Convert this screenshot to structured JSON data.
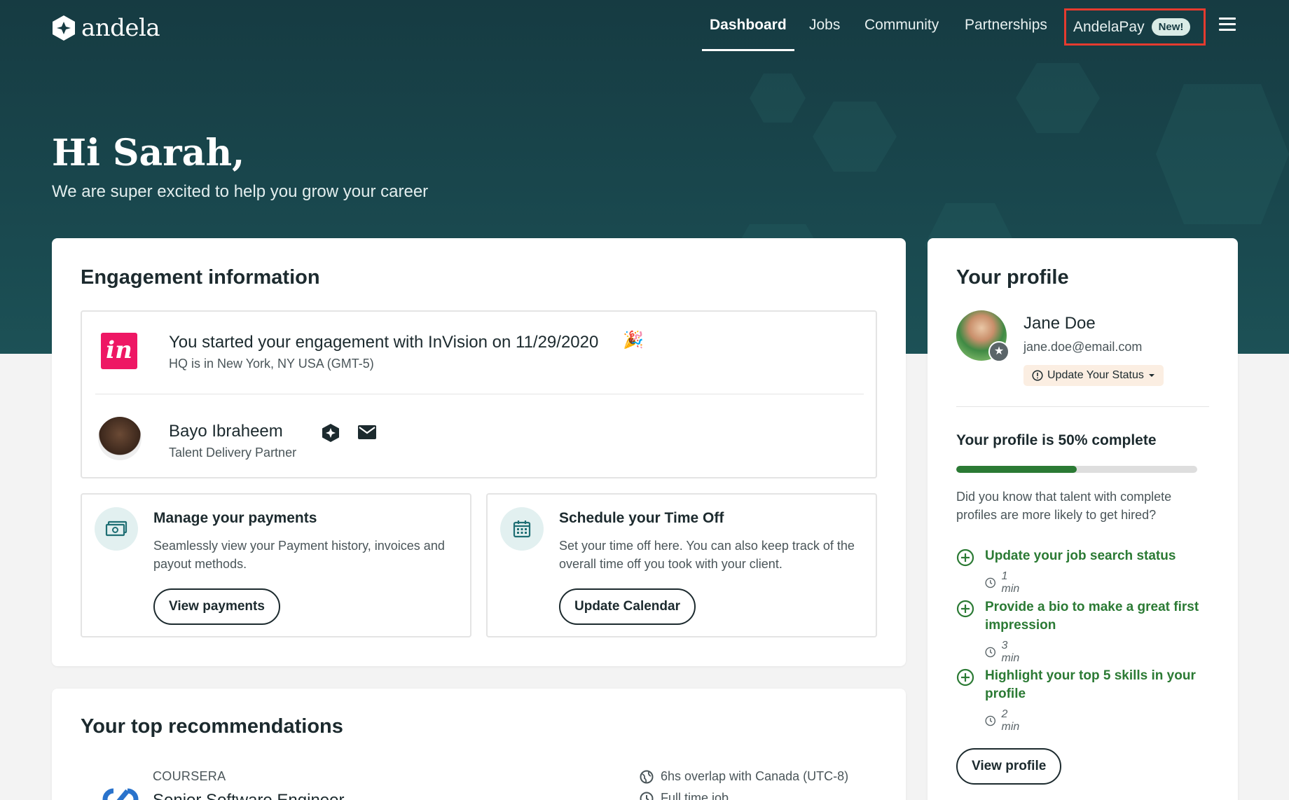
{
  "nav": {
    "brand": "andela",
    "links": [
      {
        "label": "Dashboard",
        "active": true
      },
      {
        "label": "Jobs"
      },
      {
        "label": "Community"
      },
      {
        "label": "Partnerships"
      }
    ],
    "pay_label": "AndelaPay",
    "pay_badge": "New!",
    "highlight_color": "#e53b2f"
  },
  "hero": {
    "greeting": "Hi Sarah,",
    "subtitle": "We are super excited to help you grow your career"
  },
  "engagement": {
    "title": "Engagement information",
    "company_logo_text": "in",
    "line1": "You started your engagement with InVision on 11/29/2020",
    "line2": "HQ is in New York, NY USA (GMT-5)",
    "partner_name": "Bayo Ibraheem",
    "partner_role": "Talent Delivery Partner",
    "payments": {
      "title": "Manage your payments",
      "description": "Seamlessly view your Payment history, invoices and payout methods.",
      "button": "View payments"
    },
    "timeoff": {
      "title": "Schedule your Time Off",
      "description": "Set your time off here. You can also keep track of the overall time off you took with your client.",
      "button": "Update Calendar"
    }
  },
  "recommendations": {
    "title": "Your top recommendations",
    "company": "COURSERA",
    "job_title": "Senior Software Engineer",
    "overlap": "6hs overlap with Canada (UTC-8)",
    "job_type": "Full time job"
  },
  "profile": {
    "title": "Your profile",
    "name": "Jane Doe",
    "email": "jane.doe@email.com",
    "status_button": "Update Your Status",
    "completion_text": "Your profile is 50% complete",
    "completion_percent": 50,
    "tip": "Did you know that talent with complete profiles are more likely to get hired?",
    "tasks": [
      {
        "label": "Update your job search status",
        "time": "1 min"
      },
      {
        "label": "Provide a bio to make a great first impression",
        "time": "3 min"
      },
      {
        "label": "Highlight your top 5 skills in your profile",
        "time": "2 min"
      }
    ],
    "view_button": "View profile"
  },
  "colors": {
    "hero": "#163b42",
    "accent_green": "#2b7a34",
    "invision": "#ee1764"
  }
}
